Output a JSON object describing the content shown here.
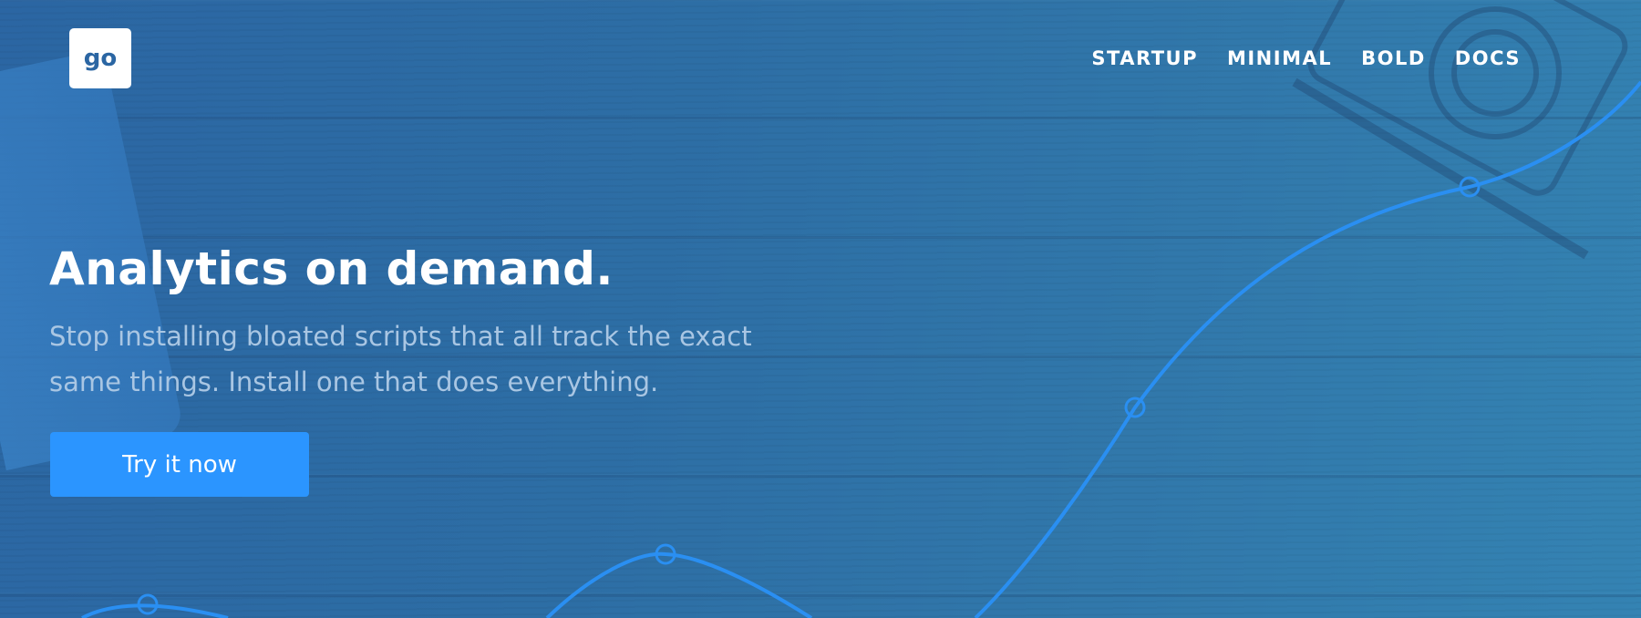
{
  "header": {
    "logo_text": "go",
    "nav": [
      {
        "label": "STARTUP"
      },
      {
        "label": "MINIMAL"
      },
      {
        "label": "BOLD"
      },
      {
        "label": "DOCS"
      }
    ]
  },
  "hero": {
    "title": "Analytics on demand.",
    "subtitle": "Stop installing bloated scripts that all track the exact same things. Install one that does everything.",
    "cta_label": "Try it now"
  },
  "colors": {
    "background": "#2e6da3",
    "accent": "#2b95ff",
    "curve": "#2a8ff2",
    "subtitle_text": "#a9c6e3"
  }
}
